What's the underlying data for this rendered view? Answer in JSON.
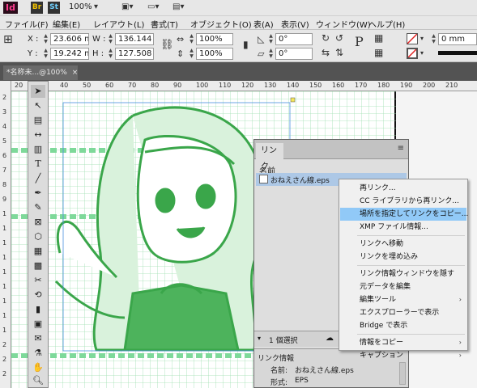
{
  "appbar": {
    "logo": "Id",
    "bridge": "Br",
    "stock": "St",
    "zoom": "100%"
  },
  "menu": {
    "items": [
      "ファイル(F)",
      "編集(E)",
      "レイアウト(L)",
      "書式(T)",
      "オブジェクト(O)",
      "表(A)",
      "表示(V)",
      "ウィンドウ(W)",
      "ヘルプ(H)"
    ]
  },
  "control": {
    "x_label": "X :",
    "x_value": "23.606 mm",
    "y_label": "Y :",
    "y_value": "19.242 mm",
    "w_label": "W :",
    "w_value": "136.144 m",
    "h_label": "H :",
    "h_value": "127.508 m",
    "scale_x": "100%",
    "scale_y": "100%",
    "angle": "0°",
    "shear": "0°",
    "stroke": "0 mm"
  },
  "document": {
    "tab_label": "*名称未...@100%"
  },
  "rulers": {
    "h": [
      "20",
      "30",
      "40",
      "50",
      "60",
      "70",
      "80",
      "90",
      "100",
      "110",
      "120",
      "130",
      "140",
      "150",
      "160",
      "170",
      "180",
      "190",
      "200",
      "210"
    ],
    "v": [
      "2",
      "3",
      "4",
      "5",
      "6",
      "7",
      "8",
      "9",
      "1",
      "1",
      "1",
      "1",
      "1",
      "1",
      "1",
      "1",
      "1",
      "2",
      "2",
      "2"
    ]
  },
  "links_panel": {
    "tab": "リンク",
    "column_header": "名前",
    "selected_file": "おねえさん線.eps",
    "footer_text": "1 個選択",
    "info_header": "リンク情報",
    "info_name_label": "名前:",
    "info_name_value": "おねえさん線.eps",
    "info_format_label": "形式:",
    "info_format_value": "EPS"
  },
  "context_menu": {
    "items": [
      {
        "label": "再リンク...",
        "submenu": false,
        "highlight": false
      },
      {
        "label": "CC ライブラリから再リンク...",
        "submenu": false,
        "highlight": false
      },
      {
        "label": "場所を指定してリンクをコピー...",
        "submenu": false,
        "highlight": true
      },
      {
        "label": "XMP ファイル情報...",
        "submenu": false,
        "highlight": false
      },
      {
        "label": "リンクへ移動",
        "submenu": false,
        "highlight": false
      },
      {
        "label": "リンクを埋め込み",
        "submenu": false,
        "highlight": false
      },
      {
        "label": "リンク情報ウィンドウを隠す",
        "submenu": false,
        "highlight": false
      },
      {
        "label": "元データを編集",
        "submenu": false,
        "highlight": false
      },
      {
        "label": "編集ツール",
        "submenu": true,
        "highlight": false
      },
      {
        "label": "エクスプローラーで表示",
        "submenu": false,
        "highlight": false
      },
      {
        "label": "Bridge で表示",
        "submenu": false,
        "highlight": false
      },
      {
        "label": "情報をコピー",
        "submenu": true,
        "highlight": false
      },
      {
        "label": "キャプション",
        "submenu": true,
        "highlight": false
      }
    ]
  },
  "colors": {
    "guide_green": "#7ed99a",
    "art_green": "#3aa64a",
    "highlight_blue": "#91c9f7"
  }
}
